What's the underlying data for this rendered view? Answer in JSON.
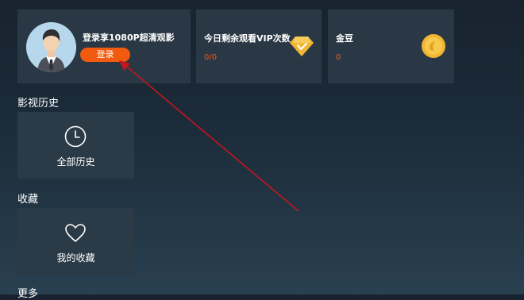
{
  "login_card": {
    "title": "登录享1080P超清观影",
    "button_label": "登录"
  },
  "vip_card": {
    "title": "今日剩余观看VIP次数",
    "value": "0/0"
  },
  "bean_card": {
    "title": "金豆",
    "value": "0"
  },
  "history": {
    "section_label": "影视历史",
    "tile_label": "全部历史"
  },
  "favorites": {
    "section_label": "收藏",
    "tile_label": "我的收藏"
  },
  "more": {
    "section_label": "更多"
  },
  "colors": {
    "accent": "#f15a0f",
    "card": "#2a3845",
    "gold": "#f1b532"
  }
}
